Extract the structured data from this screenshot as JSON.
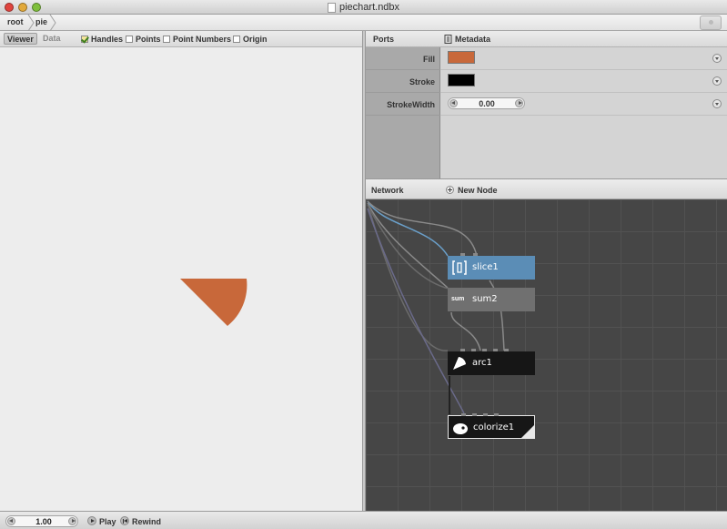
{
  "window": {
    "title": "piechart.ndbx"
  },
  "breadcrumb": [
    "root",
    "pie"
  ],
  "viewer_toolbar": {
    "tabs": [
      "Viewer",
      "Data"
    ],
    "active_tab": "Viewer",
    "options": [
      {
        "label": "Handles",
        "checked": true
      },
      {
        "label": "Points",
        "checked": false
      },
      {
        "label": "Point Numbers",
        "checked": false
      },
      {
        "label": "Origin",
        "checked": false
      }
    ]
  },
  "ports_panel": {
    "header": "Ports",
    "metadata_label": "Metadata",
    "rows": [
      {
        "label": "Fill",
        "type": "color",
        "value": "#c8683a"
      },
      {
        "label": "Stroke",
        "type": "color",
        "value": "#000000"
      },
      {
        "label": "StrokeWidth",
        "type": "number",
        "value": "0.00"
      }
    ]
  },
  "network_panel": {
    "header": "Network",
    "new_node_label": "New Node",
    "nodes": [
      {
        "name": "slice1",
        "icon": "slice-icon",
        "color": "#5b8db6"
      },
      {
        "name": "sum2",
        "icon": "sum-icon",
        "icon_text": "sum",
        "color": "#707070"
      },
      {
        "name": "arc1",
        "icon": "arc-icon",
        "color": "#161616"
      },
      {
        "name": "colorize1",
        "icon": "colorize-icon",
        "color": "#161616",
        "rendered": true
      }
    ]
  },
  "viewer_canvas": {
    "shape_fill": "#c8683a"
  },
  "statusbar": {
    "frame": "1.00",
    "play_label": "Play",
    "rewind_label": "Rewind"
  }
}
